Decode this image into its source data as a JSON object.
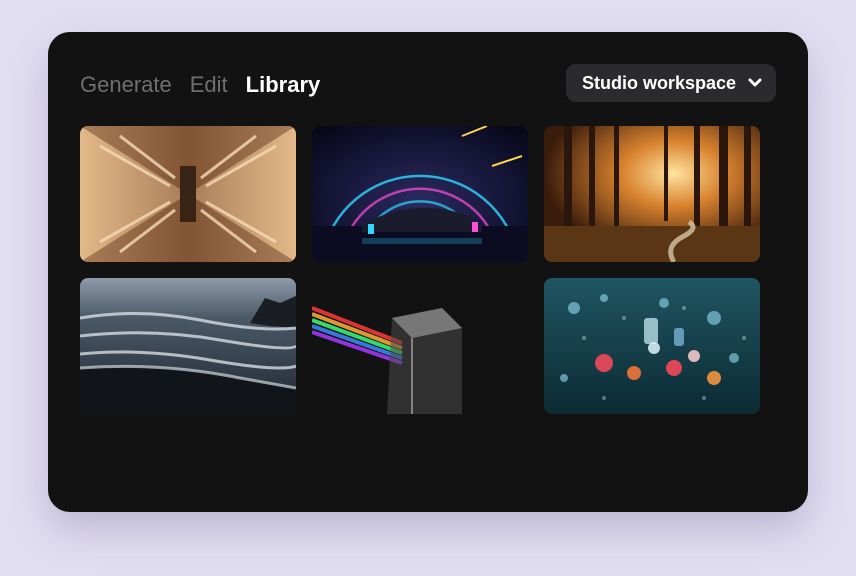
{
  "tabs": [
    {
      "label": "Generate",
      "active": false
    },
    {
      "label": "Edit",
      "active": false
    },
    {
      "label": "Library",
      "active": true
    }
  ],
  "workspace": {
    "label": "Studio workspace",
    "icon": "chevron-down-icon"
  },
  "gallery": {
    "images": [
      {
        "subject": "symmetric wooden staircase architecture"
      },
      {
        "subject": "neon car in glowing tunnel"
      },
      {
        "subject": "sunlit autumn forest with stream"
      },
      {
        "subject": "stormy ocean waves on black sand beach"
      },
      {
        "subject": "glass prism with rainbow light"
      },
      {
        "subject": "rainy window with city bokeh lights"
      }
    ]
  },
  "colors": {
    "page_background": "#e2def2",
    "panel_background": "#121212",
    "tab_inactive": "#6f6f6f",
    "tab_active": "#ffffff",
    "dropdown_background": "#2b2b2e"
  }
}
